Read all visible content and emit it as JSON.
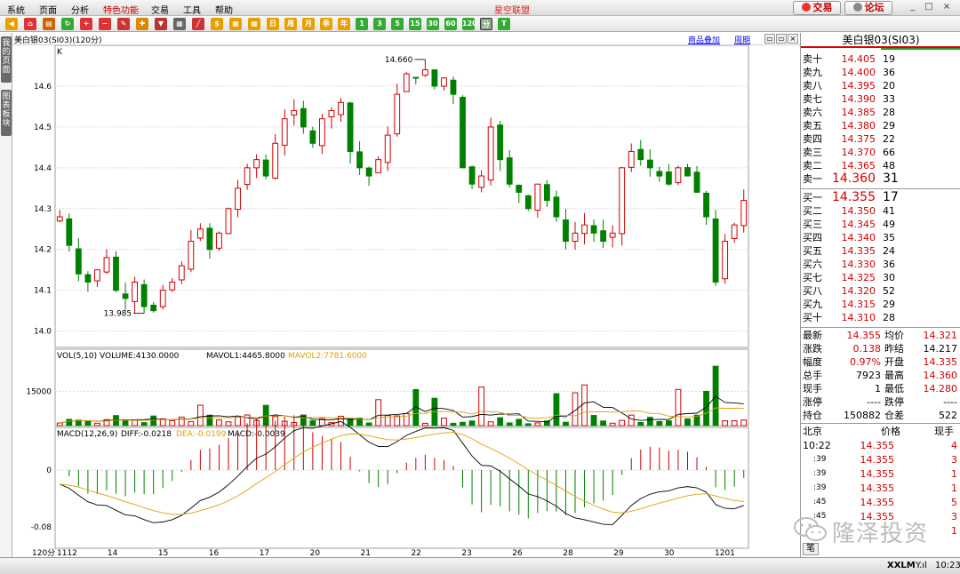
{
  "menu": {
    "items": [
      "系统",
      "页面",
      "分析",
      "特色功能",
      "交易",
      "工具",
      "帮助"
    ],
    "accent_index": 3,
    "app_title": "星空联盟",
    "trade_button": "交易",
    "forum_button": "论坛",
    "window_controls": [
      "_",
      "□",
      "×"
    ]
  },
  "toolbar": {
    "icons": [
      "back-icon",
      "home-icon",
      "list-icon",
      "refresh-icon",
      "zoom-in-icon",
      "zoom-out-icon",
      "pen-icon",
      "pin-icon",
      "filter-icon",
      "table-icon",
      "draw-icon",
      "ticker-icon",
      "calendar-icon",
      "calendar-icon",
      "period-icon",
      "period-icon",
      "period-icon",
      "period-icon",
      "period-icon",
      "period-icon",
      "period-icon",
      "period-icon",
      "period-icon",
      "period-icon",
      "period-icon",
      "period-icon",
      "period-icon",
      "period-icon"
    ],
    "period_labels": [
      "日",
      "周",
      "月",
      "季",
      "年",
      "1",
      "3",
      "5",
      "15",
      "30",
      "60",
      "120",
      "分",
      "T"
    ]
  },
  "left_tabs": [
    "我的页面",
    "图表板块"
  ],
  "chart": {
    "title": "美白银03(SI03)(120分)",
    "k_label": "K",
    "links": [
      "商品叠加",
      "周期"
    ],
    "header_icons": [
      "layout-icon",
      "layout-icon",
      "close-icon"
    ]
  },
  "chart_data": {
    "type": "candlestick",
    "period": "120分",
    "y_ticks": [
      14.0,
      14.1,
      14.2,
      14.3,
      14.4,
      14.5,
      14.6
    ],
    "ylim": [
      13.96,
      14.7
    ],
    "x_labels": [
      "1112",
      "14",
      "15",
      "16",
      "17",
      "20",
      "21",
      "22",
      "23",
      "26",
      "28",
      "29",
      "30",
      "1201"
    ],
    "max_label": "14.660",
    "min_label": "13.985",
    "close_path": [
      14.28,
      14.21,
      14.14,
      14.12,
      14.15,
      14.18,
      14.1,
      14.08,
      14.12,
      14.06,
      14.05,
      14.1,
      14.12,
      14.16,
      14.22,
      14.25,
      14.2,
      14.24,
      14.3,
      14.35,
      14.4,
      14.42,
      14.38,
      14.46,
      14.52,
      14.54,
      14.5,
      14.46,
      14.52,
      14.54,
      14.56,
      14.44,
      14.4,
      14.38,
      14.42,
      14.48,
      14.58,
      14.63,
      14.62,
      14.64,
      14.6,
      14.62,
      14.58,
      14.4,
      14.36,
      14.38,
      14.5,
      14.42,
      14.36,
      14.34,
      14.3,
      14.36,
      14.32,
      14.28,
      14.22,
      14.24,
      14.26,
      14.24,
      14.22,
      14.24,
      14.4,
      14.44,
      14.42,
      14.4,
      14.38,
      14.36,
      14.4,
      14.38,
      14.34,
      14.28,
      14.12,
      14.22,
      14.26,
      14.32
    ],
    "vol": {
      "legend": "VOL(5,10) VOLUME:4130.0000",
      "mavol1": "MAVOL1:4465.8000",
      "mavol2": "MAVOL2:7781.6000",
      "y_tick": "15000",
      "max": 28000
    },
    "macd": {
      "legend": "MACD(12,26,9)",
      "diff": "DIFF:-0.0218",
      "dea": "DEA:-0.0199",
      "macd_val": "MACD:-0.0039",
      "y_ticks": [
        "0",
        "-0.08"
      ],
      "ylim": [
        -0.11,
        0.06
      ]
    },
    "x_axis_prefix": "120分"
  },
  "orderbook": {
    "title": "美白银03(SI03)",
    "asks": [
      {
        "label": "卖十",
        "price": "14.405",
        "vol": "19"
      },
      {
        "label": "卖九",
        "price": "14.400",
        "vol": "36"
      },
      {
        "label": "卖八",
        "price": "14.395",
        "vol": "20"
      },
      {
        "label": "卖七",
        "price": "14.390",
        "vol": "33"
      },
      {
        "label": "卖六",
        "price": "14.385",
        "vol": "28"
      },
      {
        "label": "卖五",
        "price": "14.380",
        "vol": "29"
      },
      {
        "label": "卖四",
        "price": "14.375",
        "vol": "22"
      },
      {
        "label": "卖三",
        "price": "14.370",
        "vol": "66"
      },
      {
        "label": "卖二",
        "price": "14.365",
        "vol": "48"
      },
      {
        "label": "卖一",
        "price": "14.360",
        "vol": "31"
      }
    ],
    "bids": [
      {
        "label": "买一",
        "price": "14.355",
        "vol": "17"
      },
      {
        "label": "买二",
        "price": "14.350",
        "vol": "41"
      },
      {
        "label": "买三",
        "price": "14.345",
        "vol": "49"
      },
      {
        "label": "买四",
        "price": "14.340",
        "vol": "35"
      },
      {
        "label": "买五",
        "price": "14.335",
        "vol": "24"
      },
      {
        "label": "买六",
        "price": "14.330",
        "vol": "36"
      },
      {
        "label": "买七",
        "price": "14.325",
        "vol": "30"
      },
      {
        "label": "买八",
        "price": "14.320",
        "vol": "52"
      },
      {
        "label": "买九",
        "price": "14.315",
        "vol": "29"
      },
      {
        "label": "买十",
        "price": "14.310",
        "vol": "28"
      }
    ]
  },
  "quote": {
    "rows": [
      {
        "l1": "最新",
        "v1": "14.355",
        "l2": "均价",
        "v2": "14.321",
        "red1": true,
        "red2": true
      },
      {
        "l1": "涨跌",
        "v1": "0.138",
        "l2": "昨结",
        "v2": "14.217",
        "red1": true,
        "red2": false
      },
      {
        "l1": "幅度",
        "v1": "0.97%",
        "l2": "开盘",
        "v2": "14.335",
        "red1": true,
        "red2": true
      },
      {
        "l1": "总手",
        "v1": "7923",
        "l2": "最高",
        "v2": "14.360",
        "red1": false,
        "red2": true
      },
      {
        "l1": "现手",
        "v1": "1",
        "l2": "最低",
        "v2": "14.280",
        "red1": false,
        "red2": true
      },
      {
        "l1": "涨停",
        "v1": "----",
        "l2": "跌停",
        "v2": "----",
        "red1": false,
        "red2": false
      },
      {
        "l1": "持仓",
        "v1": "150882",
        "l2": "仓差",
        "v2": "522",
        "red1": false,
        "red2": false
      }
    ]
  },
  "trades": {
    "headers": [
      "北京",
      "价格",
      "现手"
    ],
    "rows": [
      {
        "time": "10:22",
        "price": "14.355",
        "vol": "4"
      },
      {
        "time": ":39",
        "price": "14.355",
        "vol": "3"
      },
      {
        "time": ":39",
        "price": "14.355",
        "vol": "1"
      },
      {
        "time": ":39",
        "price": "14.355",
        "vol": "1"
      },
      {
        "time": ":45",
        "price": "14.355",
        "vol": "5"
      },
      {
        "time": ":45",
        "price": "14.355",
        "vol": "3"
      },
      {
        "time": "",
        "price": "",
        "vol": "1"
      }
    ],
    "footer_tab": "笔"
  },
  "watermark": "隆泽投资",
  "status": {
    "brand": "XXLM",
    "signal": "Y.ıl",
    "time": "10:23"
  },
  "colors": {
    "up": "#d00000",
    "down": "#008000",
    "grid": "#d8d8d8"
  }
}
